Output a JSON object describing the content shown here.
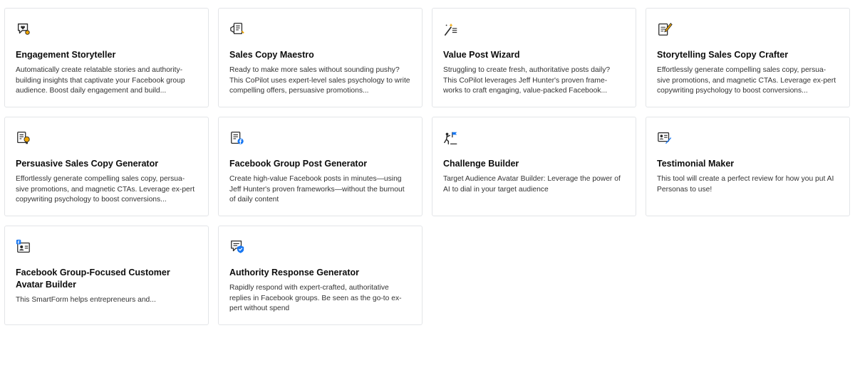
{
  "cards": [
    {
      "icon": "heart-comment-icon",
      "title": "Engagement Storyteller",
      "description": "Automatically create relatable stories and authority-building insights that captivate your Facebook group audience. Boost daily engagement and build..."
    },
    {
      "icon": "megaphone-document-icon",
      "title": "Sales Copy Maestro",
      "description": "Ready to make more sales without sounding pushy? This CoPilot uses expert-level sales psychology to write compelling offers, persuasive promotions..."
    },
    {
      "icon": "magic-wand-list-icon",
      "title": "Value Post Wizard",
      "description": "Struggling to create fresh, authoritative posts daily? This CoPilot leverages Jeff Hunter's proven frame-works to craft engaging, value-packed Facebook..."
    },
    {
      "icon": "pen-paper-icon",
      "title": "Storytelling Sales Copy Crafter",
      "description": "Effortlessly generate compelling sales copy, persua-sive promotions, and magnetic CTAs. Leverage ex-pert copywriting psychology to boost conversions..."
    },
    {
      "icon": "document-lightbulb-icon",
      "title": "Persuasive Sales Copy Generator",
      "description": "Effortlessly generate compelling sales copy, persua-sive promotions, and magnetic CTAs. Leverage ex-pert copywriting psychology to boost conversions..."
    },
    {
      "icon": "facebook-post-icon",
      "title": "Facebook Group Post Generator",
      "description": "Create high-value Facebook posts in minutes—using Jeff Hunter's proven frameworks—without the burnout of daily content"
    },
    {
      "icon": "climbing-flag-icon",
      "title": "Challenge Builder",
      "description": "Target Audience Avatar Builder: Leverage the power of AI to dial in your target audience"
    },
    {
      "icon": "testimonial-card-icon",
      "title": "Testimonial Maker",
      "description": "This tool will create a perfect review for how you put AI Personas to use!"
    },
    {
      "icon": "facebook-avatar-card-icon",
      "title": "Facebook Group-Focused Customer Avatar Builder",
      "description": "This SmartForm helps entrepreneurs and..."
    },
    {
      "icon": "shield-comment-icon",
      "title": "Authority Response Generator",
      "description": "Rapidly respond with expert-crafted, authoritative replies in Facebook groups. Be seen as the go-to ex-pert without spend"
    }
  ],
  "colors": {
    "border": "#e3e5e8",
    "accent_blue": "#1877f2",
    "accent_orange": "#f0a500",
    "icon_stroke": "#2b2b2b"
  }
}
